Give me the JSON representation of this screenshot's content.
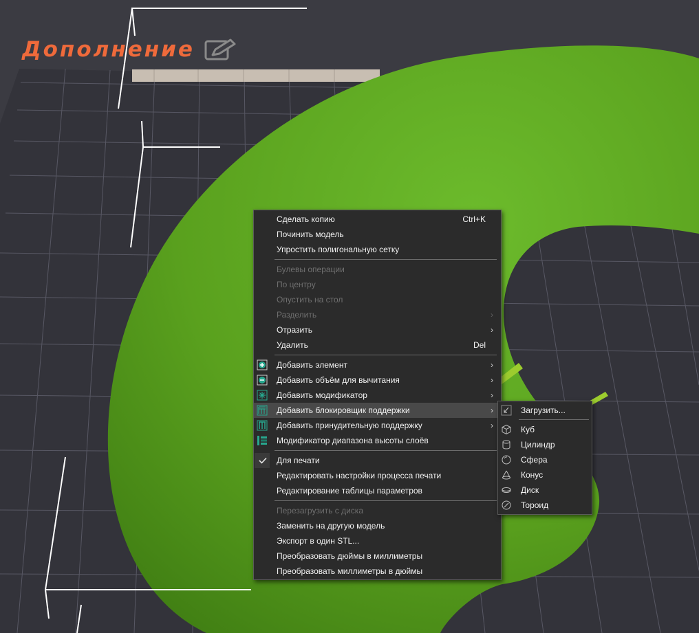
{
  "banner": {
    "title": "Дополнение"
  },
  "context_menu": {
    "items": [
      {
        "label": "Сделать копию",
        "shortcut": "Ctrl+K"
      },
      {
        "label": "Починить модель"
      },
      {
        "label": "Упростить полигональную сетку"
      },
      {
        "label": "Булевы операции"
      },
      {
        "label": "По центру"
      },
      {
        "label": "Опустить на стол"
      },
      {
        "label": "Разделить"
      },
      {
        "label": "Отразить"
      },
      {
        "label": "Удалить",
        "shortcut": "Del"
      },
      {
        "label": "Добавить элемент",
        "icon": "add-part-icon"
      },
      {
        "label": "Добавить объём для вычитания",
        "icon": "add-negative-volume-icon"
      },
      {
        "label": "Добавить модификатор",
        "icon": "add-modifier-icon"
      },
      {
        "label": "Добавить блокировщик поддержки",
        "icon": "support-blocker-icon"
      },
      {
        "label": "Добавить принудительную поддержку",
        "icon": "support-enforcer-icon"
      },
      {
        "label": "Модификатор диапазона высоты слоёв",
        "icon": "layer-range-icon"
      },
      {
        "label": "Для печати",
        "icon": "checkmark-icon"
      },
      {
        "label": "Редактировать настройки процесса печати"
      },
      {
        "label": "Редактирование таблицы параметров"
      },
      {
        "label": "Перезагрузить с диска"
      },
      {
        "label": "Заменить на другую модель"
      },
      {
        "label": "Экспорт в один STL..."
      },
      {
        "label": "Преобразовать дюймы в миллиметры"
      },
      {
        "label": "Преобразовать миллиметры в дюймы"
      }
    ]
  },
  "submenu": {
    "items": [
      {
        "label": "Загрузить...",
        "icon": "load-icon"
      },
      {
        "label": "Куб",
        "icon": "cube-icon"
      },
      {
        "label": "Цилиндр",
        "icon": "cylinder-icon"
      },
      {
        "label": "Сфера",
        "icon": "sphere-icon"
      },
      {
        "label": "Конус",
        "icon": "cone-icon"
      },
      {
        "label": "Диск",
        "icon": "disc-icon"
      },
      {
        "label": "Тороид",
        "icon": "torus-icon"
      }
    ]
  },
  "colors": {
    "background": "#3d3d44",
    "grid_line": "#5b5b66",
    "torus_green": "#5aa31e",
    "banner_orange": "#ef6a3b",
    "annotation_arrow": "#9ccc2e",
    "menu_bg": "#2b2b2b",
    "menu_highlight": "#494949",
    "accent_teal": "#27a88f"
  }
}
